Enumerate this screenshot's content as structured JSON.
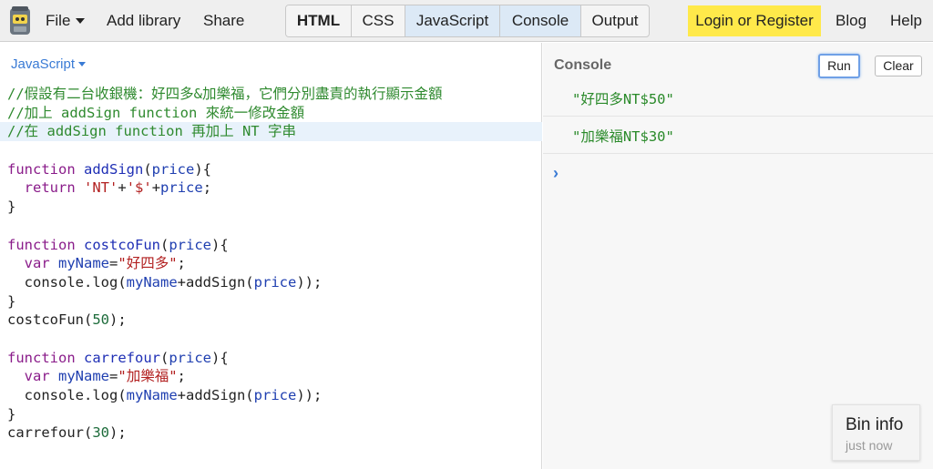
{
  "header": {
    "menu": {
      "file": "File",
      "add_library": "Add library",
      "share": "Share"
    },
    "tabs": [
      {
        "label": "HTML",
        "active": false
      },
      {
        "label": "CSS",
        "active": false
      },
      {
        "label": "JavaScript",
        "active": true
      },
      {
        "label": "Console",
        "active": true
      },
      {
        "label": "Output",
        "active": false
      }
    ],
    "login": "Login or Register",
    "blog": "Blog",
    "help": "Help"
  },
  "editor": {
    "language": "JavaScript",
    "lines": [
      "//假設有二台收銀機：好四多&加樂福，它們分別盡責的執行顯示金額",
      "//加上 addSign function 來統一修改金額",
      "//在 addSign function 再加上 NT 字串",
      "",
      "function addSign(price){",
      "  return 'NT'+'$'+price;",
      "}",
      "",
      "function costcoFun(price){",
      "  var myName=\"好四多\";",
      "  console.log(myName+addSign(price));",
      "}",
      "costcoFun(50);",
      "",
      "function carrefour(price){",
      "  var myName=\"加樂福\";",
      "  console.log(myName+addSign(price));",
      "}",
      "carrefour(30);"
    ]
  },
  "console": {
    "title": "Console",
    "run": "Run",
    "clear": "Clear",
    "output": [
      "\"好四多NT$50\"",
      "\"加樂福NT$30\""
    ],
    "prompt": "›"
  },
  "bin_info": {
    "title": "Bin info",
    "subtitle": "just now"
  },
  "colors": {
    "accent": "#3a7bd5",
    "login_bg": "#ffe94a",
    "comment": "#2f8a2f",
    "keyword": "#8a1c8a",
    "string": "#b22020"
  }
}
